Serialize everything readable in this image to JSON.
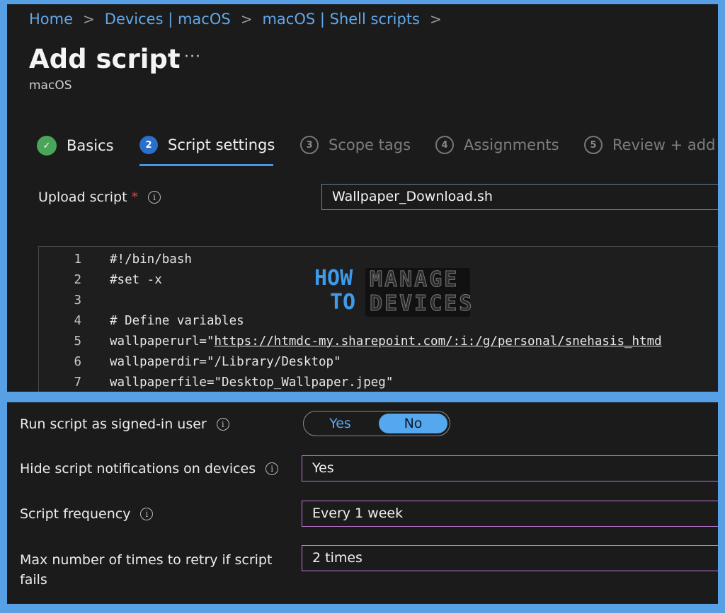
{
  "breadcrumb": [
    "Home",
    "Devices | macOS",
    "macOS | Shell scripts"
  ],
  "page": {
    "title": "Add script",
    "more": "···",
    "subtitle": "macOS"
  },
  "steps": [
    {
      "number": "✓",
      "label": "Basics",
      "state": "done"
    },
    {
      "number": "2",
      "label": "Script settings",
      "state": "active"
    },
    {
      "number": "3",
      "label": "Scope tags",
      "state": "inactive"
    },
    {
      "number": "4",
      "label": "Assignments",
      "state": "inactive"
    },
    {
      "number": "5",
      "label": "Review + add",
      "state": "inactive"
    }
  ],
  "upload": {
    "label": "Upload script",
    "required": "*",
    "value": "Wallpaper_Download.sh"
  },
  "code": [
    {
      "n": "1",
      "pre": "#!/bin/bash",
      "url": "",
      "post": ""
    },
    {
      "n": "2",
      "pre": "#set -x",
      "url": "",
      "post": ""
    },
    {
      "n": "3",
      "pre": "",
      "url": "",
      "post": ""
    },
    {
      "n": "4",
      "pre": "# Define variables",
      "url": "",
      "post": ""
    },
    {
      "n": "5",
      "pre": "wallpaperurl=\"",
      "url": "https://htmdc-my.sharepoint.com/:i:/g/personal/snehasis_htmd",
      "post": ""
    },
    {
      "n": "6",
      "pre": "wallpaperdir=\"/Library/Desktop\"",
      "url": "",
      "post": ""
    },
    {
      "n": "7",
      "pre": "wallpaperfile=\"Desktop_Wallpaper.jpeg\"",
      "url": "",
      "post": ""
    }
  ],
  "watermark": {
    "how": "HOW",
    "to": "TO",
    "manage": "MANAGE",
    "devices": "DEVICES"
  },
  "settings": {
    "run_as_user": {
      "label": "Run script as signed-in user",
      "yes": "Yes",
      "no": "No",
      "selected": "No"
    },
    "hide_notifications": {
      "label": "Hide script notifications on devices",
      "value": "Yes"
    },
    "frequency": {
      "label": "Script frequency",
      "value": "Every 1 week"
    },
    "retry": {
      "label_line1": "Max number of times to retry if script",
      "label_line2": "fails",
      "value": "2 times"
    }
  },
  "colors": {
    "accent": "#4b95e6",
    "link": "#62a8ea",
    "frame": "#57a0e6",
    "success": "#4aa55a",
    "required": "#e0454a",
    "select_border": "#c07ad8"
  }
}
